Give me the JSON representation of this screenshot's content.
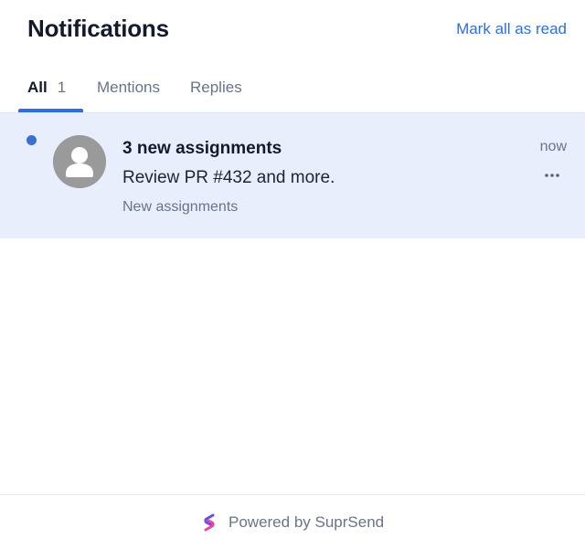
{
  "header": {
    "title": "Notifications",
    "mark_all_label": "Mark all as read"
  },
  "tabs": [
    {
      "label": "All",
      "count": "1",
      "active": true
    },
    {
      "label": "Mentions",
      "count": "",
      "active": false
    },
    {
      "label": "Replies",
      "count": "",
      "active": false
    }
  ],
  "notifications": [
    {
      "title": "3 new assignments",
      "body": "Review PR #432 and more.",
      "subtext": "New assignments",
      "time": "now",
      "unread": true,
      "avatar_icon": "user-avatar-icon",
      "menu_icon": "more-horizontal-icon"
    }
  ],
  "footer": {
    "powered_by": "Powered by SuprSend",
    "logo_icon": "suprsend-logo-icon"
  },
  "colors": {
    "accent": "#2f6fdd",
    "unread_bg": "#e8eefb",
    "unread_dot": "#3a6ed9",
    "muted_text": "#69738a"
  }
}
